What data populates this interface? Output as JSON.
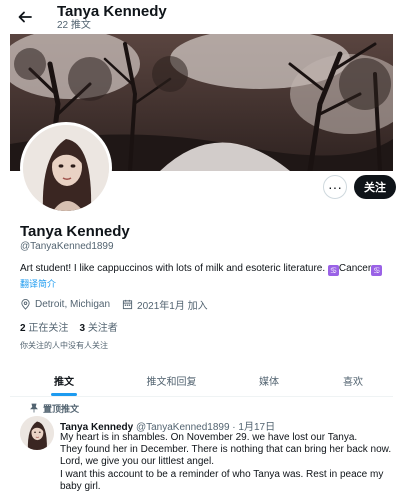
{
  "header": {
    "back_icon": "arrow-left-icon",
    "name": "Tanya Kennedy",
    "tweet_count": "22 推文"
  },
  "profile": {
    "name": "Tanya Kennedy",
    "handle": "@TanyaKenned1899",
    "bio": "Art student! I like cappuccinos with lots of milk and esoteric literature. ",
    "bio_tag": "Cancer",
    "translate": "翻译简介",
    "location": "Detroit, Michigan",
    "joined": "2021年1月 加入",
    "following_count": "2",
    "following_label": "正在关注",
    "followers_count": "3",
    "followers_label": "关注者",
    "no_followers_you_know": "你关注的人中没有人关注"
  },
  "actions": {
    "more": "···",
    "follow": "关注"
  },
  "tabs": [
    {
      "label": "推文"
    },
    {
      "label": "推文和回复"
    },
    {
      "label": "媒体"
    },
    {
      "label": "喜欢"
    }
  ],
  "pinned_tweet": {
    "pinned_label": "置顶推文",
    "author": "Tanya Kennedy",
    "handle_date": "@TanyaKenned1899 · 1月17日",
    "lines": [
      "My heart is in shambles. On November 29. we have lost our Tanya.",
      "They found her in December. There is nothing that can bring her back now.",
      "Lord, we give you our littlest angel.",
      "I want this account to be a reminder of who Tanya was. Rest in peace my",
      "baby girl."
    ]
  },
  "colors": {
    "accent": "#1d9bf0",
    "text": "#0f1419",
    "secondary": "#536471",
    "tag": "#9a62e6"
  }
}
